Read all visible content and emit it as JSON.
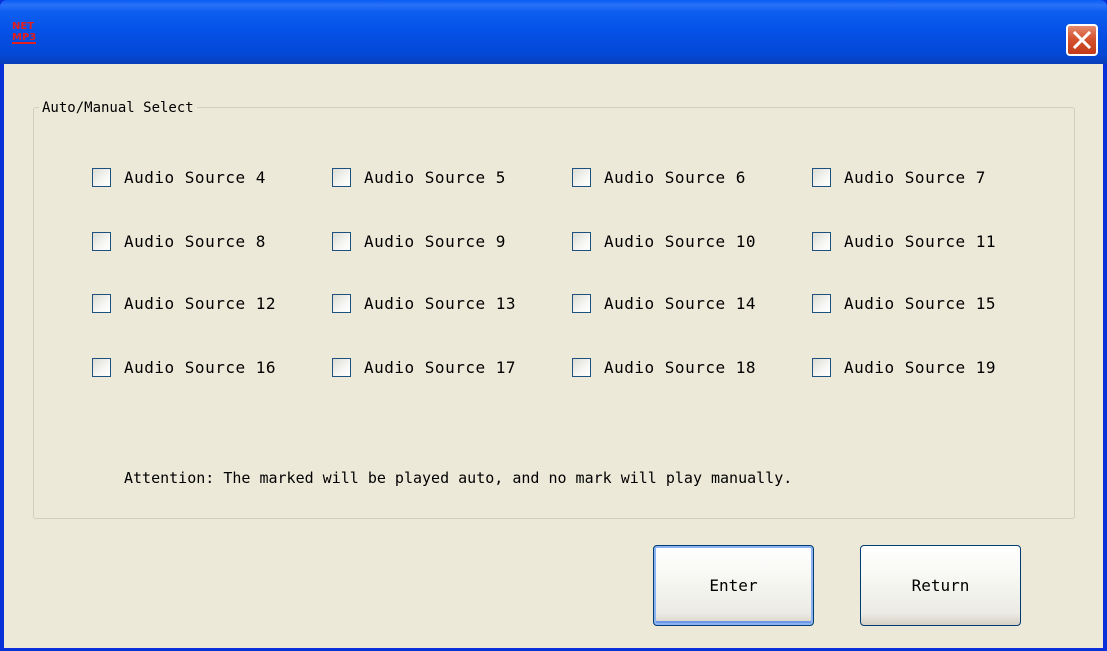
{
  "window": {
    "title": "",
    "icon": "app-logo-icon",
    "icon_text": "NET MP3",
    "close_icon": "close-icon"
  },
  "group": {
    "legend": "Auto/Manual Select",
    "checkboxes": [
      {
        "label": "Audio Source 4",
        "checked": false
      },
      {
        "label": "Audio Source 5",
        "checked": false
      },
      {
        "label": "Audio Source 6",
        "checked": false
      },
      {
        "label": "Audio Source 7",
        "checked": false
      },
      {
        "label": "Audio Source 8",
        "checked": false
      },
      {
        "label": "Audio Source 9",
        "checked": false
      },
      {
        "label": "Audio Source 10",
        "checked": false
      },
      {
        "label": "Audio Source 11",
        "checked": false
      },
      {
        "label": "Audio Source 12",
        "checked": false
      },
      {
        "label": "Audio Source 13",
        "checked": false
      },
      {
        "label": "Audio Source 14",
        "checked": false
      },
      {
        "label": "Audio Source 15",
        "checked": false
      },
      {
        "label": "Audio Source 16",
        "checked": false
      },
      {
        "label": "Audio Source 17",
        "checked": false
      },
      {
        "label": "Audio Source 18",
        "checked": false
      },
      {
        "label": "Audio Source 19",
        "checked": false
      }
    ],
    "attention": "Attention: The marked will be played auto, and no mark will play manually."
  },
  "buttons": {
    "enter": "Enter",
    "return": "Return"
  },
  "colors": {
    "titlebar": "#0550e6",
    "client_bg": "#ece9d8",
    "close_button": "#d5532f"
  }
}
